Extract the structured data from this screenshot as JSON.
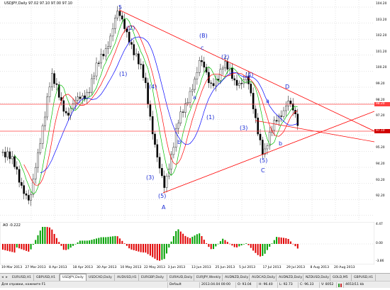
{
  "chart": {
    "title": "USDJPY,Daily  97.02 97.10 97.00 97.10",
    "price_ticks": [
      "104.20",
      "103.20",
      "102.20",
      "101.20",
      "100.20",
      "99.20",
      "98.20",
      "97.20",
      "96.20",
      "95.20",
      "94.20",
      "93.20",
      "92.20"
    ],
    "price_labels": {
      "upper": "98.20",
      "current": "97.10"
    },
    "colors": {
      "line": "#ff0000",
      "support": "#ff4040",
      "bull": "#00a000",
      "bear": "#e00000",
      "ma_blue": "#0000ff",
      "ma_green": "#00c000",
      "ma_red": "#ff0000",
      "wave": "#1a2bd4"
    }
  },
  "waves": [
    {
      "label": "5"
    },
    {
      "label": "(2)"
    },
    {
      "label": "(1)"
    },
    {
      "label": "(B)"
    },
    {
      "label": "c"
    },
    {
      "label": "(2)"
    },
    {
      "label": "(4)"
    },
    {
      "label": "(4)"
    },
    {
      "label": "a"
    },
    {
      "label": "(1)"
    },
    {
      "label": "b"
    },
    {
      "label": "(3)"
    },
    {
      "label": "(3)"
    },
    {
      "label": "a"
    },
    {
      "label": "D"
    },
    {
      "label": "b"
    },
    {
      "label": "(5)"
    },
    {
      "label": "C"
    },
    {
      "label": "(5)"
    },
    {
      "label": "A"
    }
  ],
  "ao": {
    "title": "AO -0.222",
    "ticks": [
      "4.47",
      "0.00",
      "-3.86"
    ],
    "colors": {
      "up": "#00a000",
      "down": "#e00000"
    }
  },
  "dates": [
    "19 Mar 2013",
    "27 Mar 2013",
    "8 Apr 2013",
    "18 Apr 2013",
    "30 Apr 2013",
    "10 May 2013",
    "22 May 2013",
    "3 Jun 2013",
    "13 Jun 2013",
    "25 Jun 2013",
    "5 Jul 2013",
    "17 Jul 2013",
    "29 Jul 2013",
    "8 Aug 2013",
    "20 Aug 2013"
  ],
  "tabs": [
    "EURUSD,H1",
    "GBPUSD,H1",
    "USDJPY,Daily",
    "USDCAD,Daily",
    "AUDUSD,H1",
    "EURGBP,Daily",
    "EURAUD,Daily",
    "EURJPY,Weekly",
    "AUDNZD,Daily",
    "AUDCAD,Daily",
    "AUDNZD,Daily",
    "NZDUSD,Daily",
    "GOLD,M5",
    "GBPUSD,H1"
  ],
  "status": {
    "hint": "Для справки, нажмите F1",
    "profile": "Default",
    "datetime": "2013.04.04 00:00",
    "open": "O: 93.04",
    "high": "H: 96.40",
    "low": "L: 92.73",
    "close": "C: 96.33",
    "volume": "V: 8052",
    "traffic": "4653/11 kb"
  }
}
